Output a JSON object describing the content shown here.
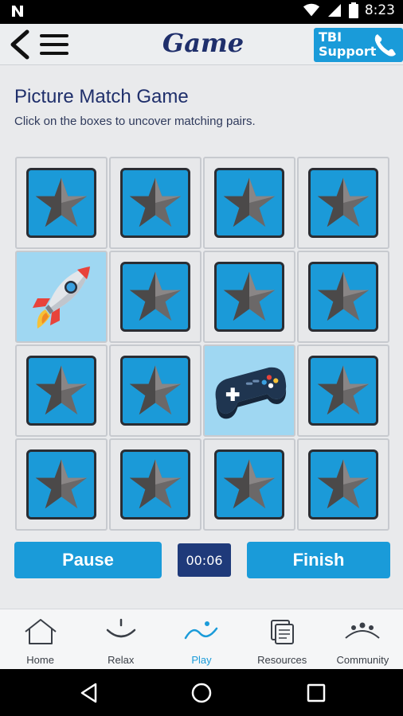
{
  "status_bar": {
    "time": "8:23",
    "left_icon": "n-notification-icon",
    "icons": [
      "wifi-icon",
      "signal-icon",
      "battery-icon"
    ]
  },
  "header": {
    "title": "Game",
    "support_label": "TBI\nSupport",
    "back_icon": "back-arrow-icon",
    "menu_icon": "hamburger-menu-icon",
    "phone_icon": "phone-icon"
  },
  "game": {
    "title": "Picture Match Game",
    "subtitle": "Click on the boxes to uncover matching pairs.",
    "cards": [
      "hidden",
      "hidden",
      "hidden",
      "hidden",
      "rocket",
      "hidden",
      "hidden",
      "hidden",
      "hidden",
      "hidden",
      "gamepad",
      "hidden",
      "hidden",
      "hidden",
      "hidden",
      "hidden"
    ]
  },
  "controls": {
    "pause_label": "Pause",
    "timer": "00:06",
    "finish_label": "Finish"
  },
  "tabs": [
    {
      "label": "Home",
      "icon": "home-icon",
      "active": false
    },
    {
      "label": "Relax",
      "icon": "relax-smile-icon",
      "active": false
    },
    {
      "label": "Play",
      "icon": "play-wave-icon",
      "active": true
    },
    {
      "label": "Resources",
      "icon": "resources-docs-icon",
      "active": false
    },
    {
      "label": "Community",
      "icon": "community-people-icon",
      "active": false
    }
  ],
  "colors": {
    "accent": "#1a9bd9",
    "navy": "#1f2f6b",
    "timer_bg": "#1f3a7a",
    "revealed_bg": "#9fd7f2"
  }
}
